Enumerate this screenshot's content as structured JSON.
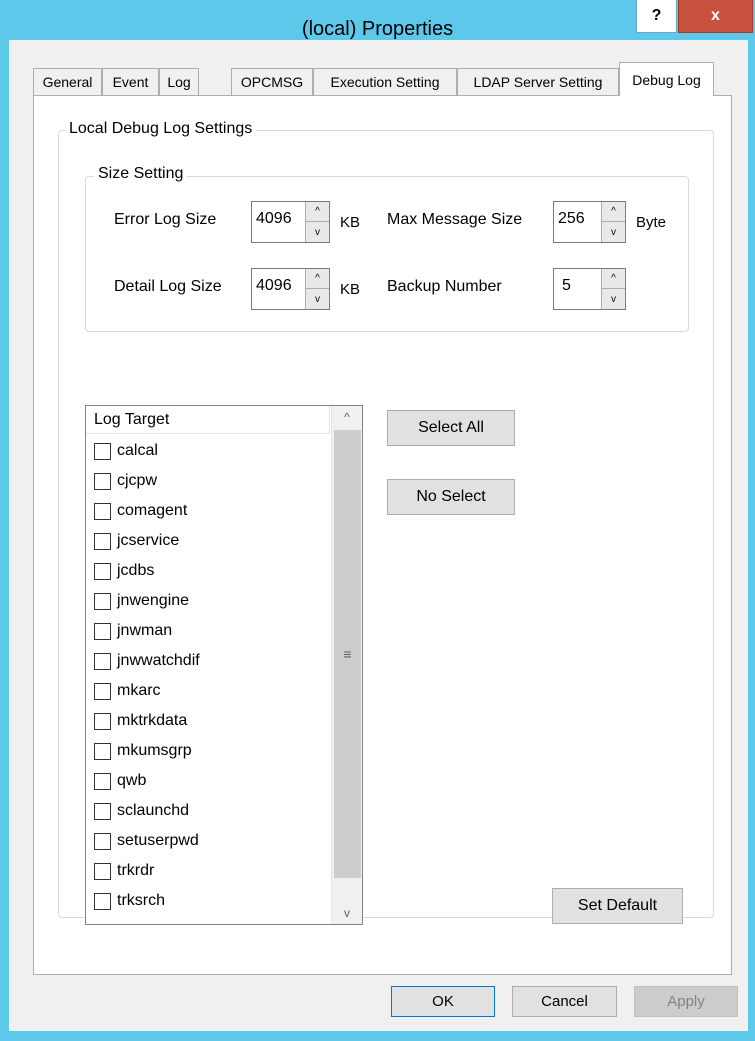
{
  "window": {
    "title": "(local) Properties",
    "help_glyph": "?",
    "close_glyph": "x"
  },
  "tabs": [
    {
      "label": "General"
    },
    {
      "label": "Event"
    },
    {
      "label": "Log"
    },
    {
      "label": "OPCMSG"
    },
    {
      "label": "Execution Setting"
    },
    {
      "label": "LDAP Server Setting"
    },
    {
      "label": "Debug Log",
      "active": true
    }
  ],
  "debug_log": {
    "group_title": "Local Debug Log Settings",
    "size_setting": {
      "title": "Size Setting",
      "error_log_size": {
        "label": "Error Log Size",
        "value": "4096",
        "unit": "KB"
      },
      "detail_log_size": {
        "label": "Detail Log Size",
        "value": "4096",
        "unit": "KB"
      },
      "max_message_size": {
        "label": "Max Message Size",
        "value": "256",
        "unit": "Byte"
      },
      "backup_number": {
        "label": "Backup Number",
        "value": "5"
      }
    },
    "log_target": {
      "header": "Log Target",
      "items": [
        "calcal",
        "cjcpw",
        "comagent",
        "jcservice",
        "jcdbs",
        "jnwengine",
        "jnwman",
        "jnwwatchdif",
        "mkarc",
        "mktrkdata",
        "mkumsgrp",
        "qwb",
        "sclaunchd",
        "setuserpwd",
        "trkrdr",
        "trksrch"
      ]
    },
    "buttons": {
      "select_all": "Select All",
      "no_select": "No Select",
      "set_default": "Set Default"
    }
  },
  "footer": {
    "ok": "OK",
    "cancel": "Cancel",
    "apply": "Apply"
  },
  "glyphs": {
    "up": "^",
    "down": "v",
    "scroll_grip": "≡"
  },
  "colors": {
    "titlebar": "#5ec8ea",
    "close": "#c7523e",
    "dialog_bg": "#f0f0f0"
  }
}
